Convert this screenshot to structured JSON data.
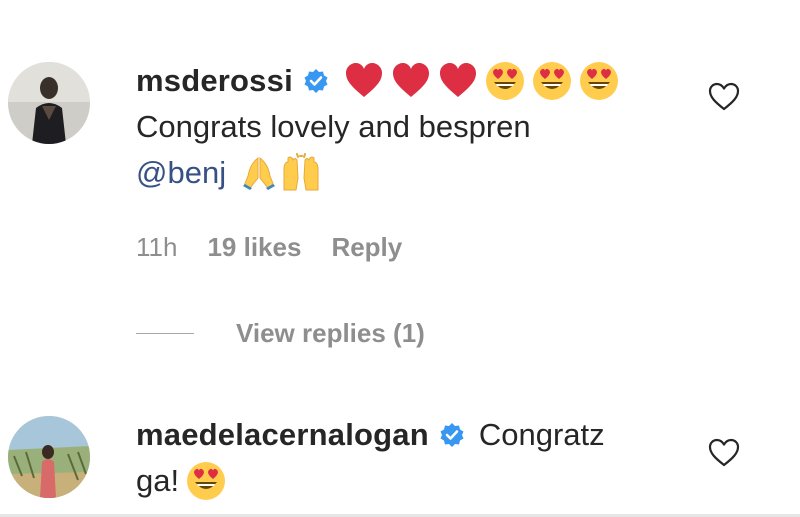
{
  "comments": [
    {
      "username": "msderossi",
      "verified": true,
      "emojis": [
        "red-heart",
        "red-heart",
        "red-heart",
        "heart-eyes",
        "heart-eyes",
        "heart-eyes"
      ],
      "text": "Congrats lovely and bespren",
      "mention": "@benj",
      "trailing_emojis": [
        "folded-hands",
        "raised-hands"
      ],
      "time": "11h",
      "likes": "19 likes",
      "reply_label": "Reply",
      "view_replies": "View replies (1)"
    },
    {
      "username": "maedelacernalogan",
      "verified": true,
      "text_part1": "Congratz",
      "text_part2": "ga!",
      "trailing_emojis": [
        "heart-eyes"
      ]
    }
  ],
  "colors": {
    "text": "#262626",
    "muted": "#8e8e8e",
    "mention": "#385185",
    "verified": "#3897f0",
    "heart_emoji": "#dd2e44",
    "smiley": "#ffcc4d"
  },
  "icons": [
    "verified-badge-icon",
    "like-heart-icon",
    "red-heart-emoji",
    "heart-eyes-emoji",
    "folded-hands-emoji",
    "raised-hands-emoji"
  ]
}
